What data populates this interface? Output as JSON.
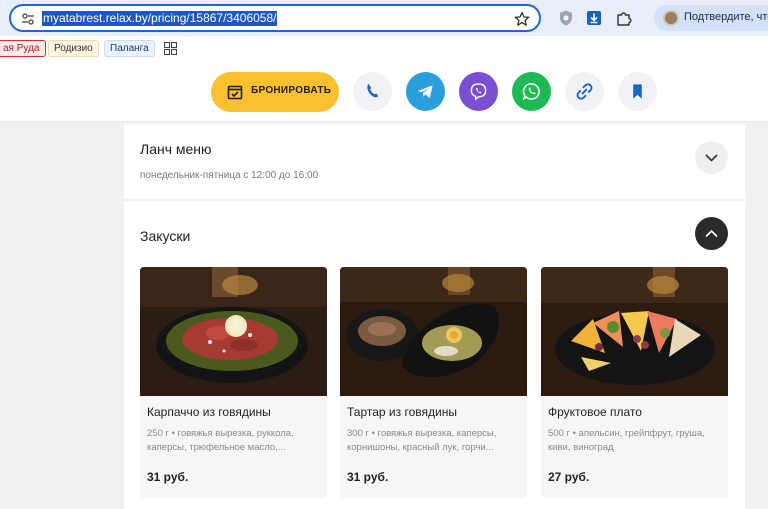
{
  "browser": {
    "url": "myatabrest.relax.by/pricing/15867/3406058/",
    "profile_text": "Подтвердите, что з"
  },
  "bookmarks": [
    {
      "label": "ая Руда"
    },
    {
      "label": "Родизио"
    },
    {
      "label": "Паланга"
    }
  ],
  "header": {
    "book_label": "БРОНИРОВАТЬ",
    "colors": {
      "book": "#fbc02d",
      "telegram": "#2a9fdb",
      "viber": "#7a4fd3",
      "whatsapp": "#1db954",
      "accent": "#1a66d6"
    }
  },
  "lunch": {
    "title": "Ланч меню",
    "subtitle": "понедельник-пятница с 12:00 до 16:00"
  },
  "snacks": {
    "title": "Закуски",
    "dishes": [
      {
        "name": "Карпаччо из говядины",
        "desc": "250 г • говяжья вырезка, руккола, каперсы, трюфельное масло,...",
        "price": "31 руб."
      },
      {
        "name": "Тартар из говядины",
        "desc": "300 г • говяжья вырезка, каперсы, корнишоны, красный лук, горчи...",
        "price": "31 руб."
      },
      {
        "name": "Фруктовое плато",
        "desc": "500 г • апельсин, грейпфрут, груша, киви, виноград",
        "price": "27 руб."
      }
    ]
  }
}
